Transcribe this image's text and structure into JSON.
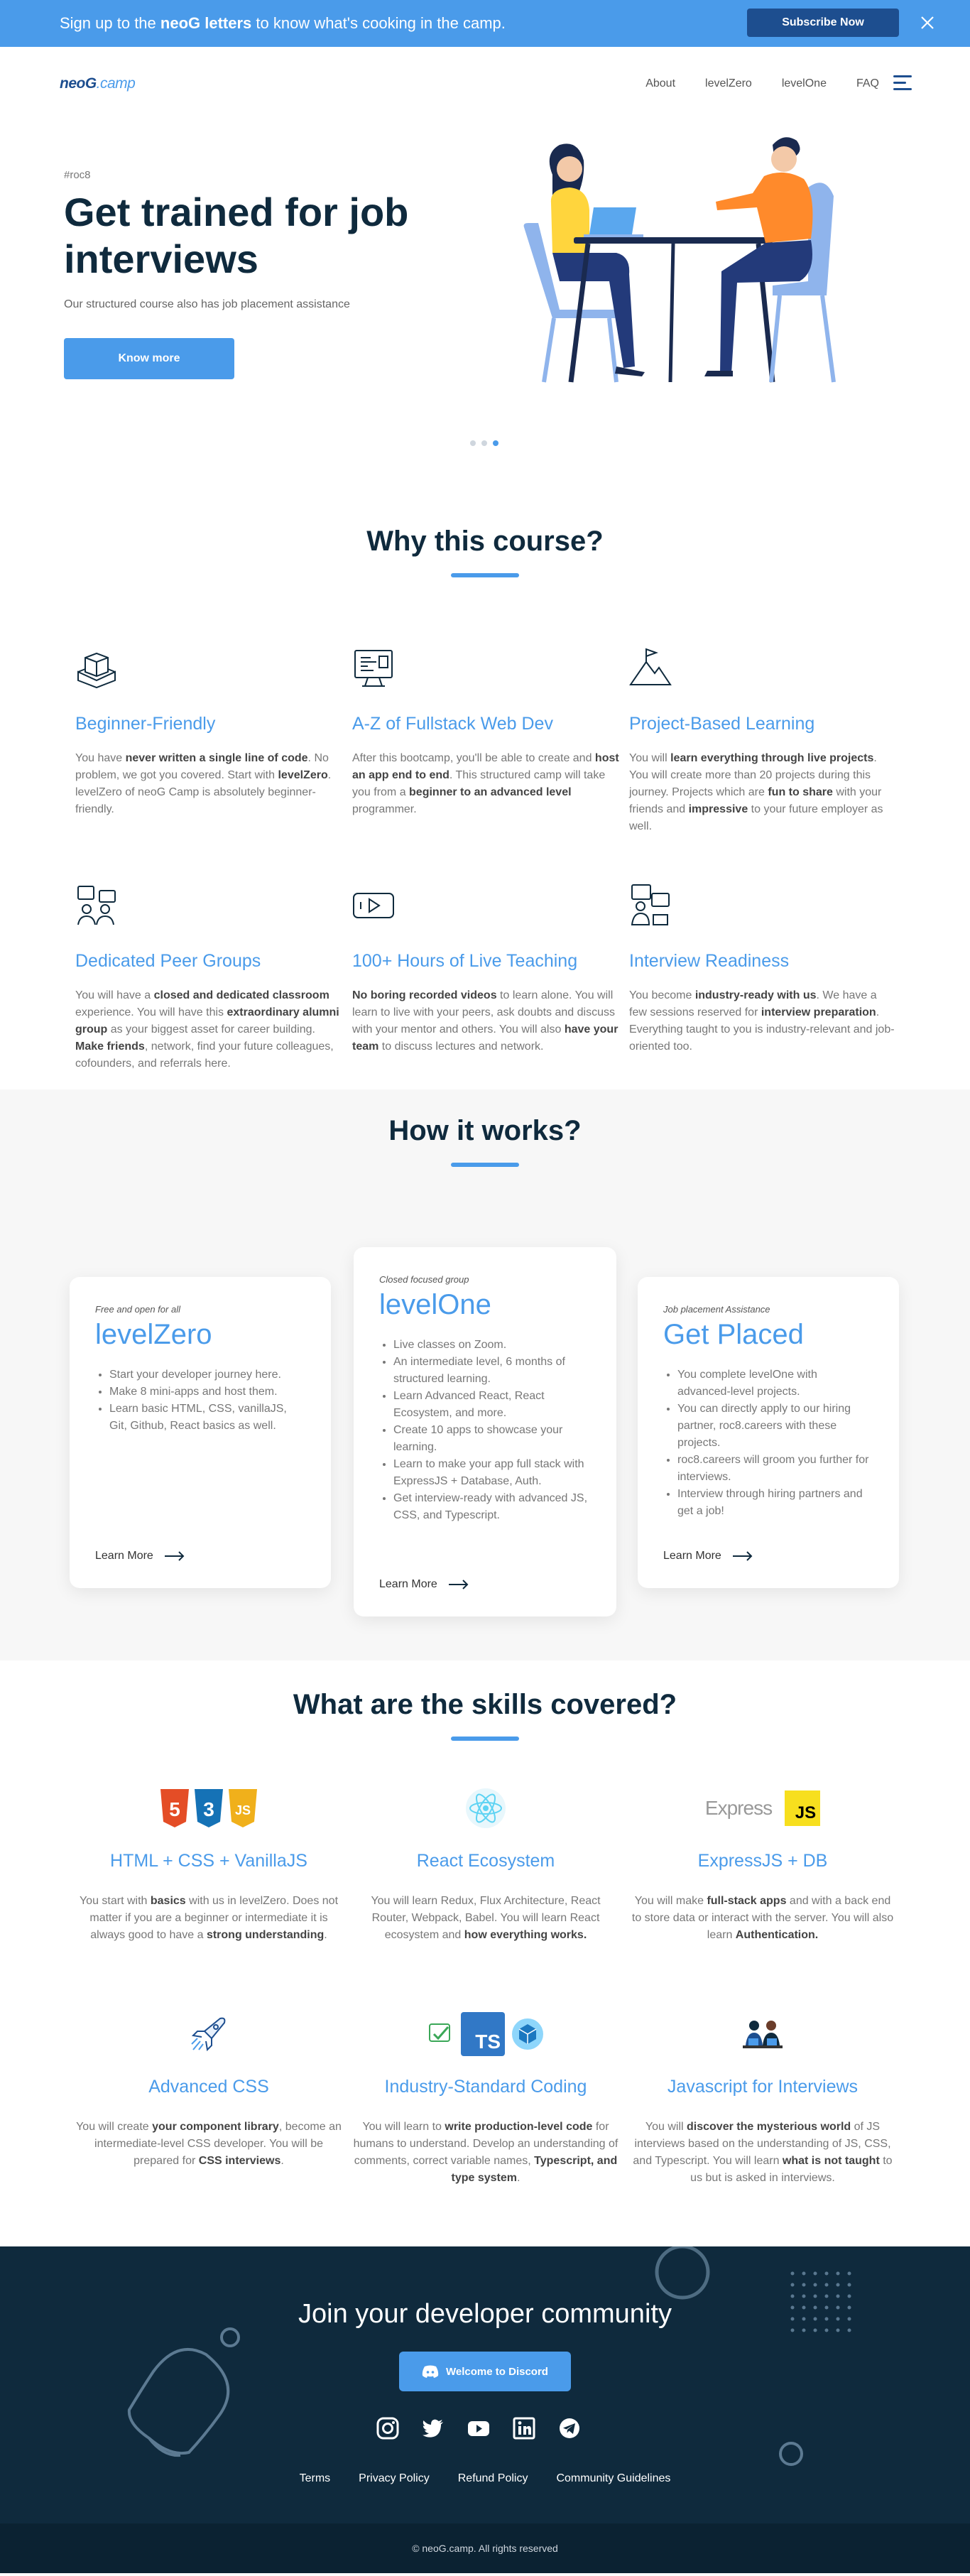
{
  "banner": {
    "text_pre": "Sign up to the ",
    "text_bold": "neoG letters",
    "text_post": " to know what's cooking in the camp.",
    "button": "Subscribe Now"
  },
  "nav": {
    "logo_main": "neoG",
    "logo_dot": ".camp",
    "links": [
      "About",
      "levelZero",
      "levelOne",
      "FAQ"
    ]
  },
  "hero": {
    "tag": "#roc8",
    "title": "Get trained for job interviews",
    "subtitle": "Our structured course also has job placement assistance",
    "button": "Know more"
  },
  "why": {
    "title": "Why this course?",
    "features": [
      {
        "icon": "blocks-icon",
        "title": "Beginner-Friendly",
        "parts": [
          [
            "You have ",
            0
          ],
          [
            "never written a single line of code",
            1
          ],
          [
            ". No problem, we got you covered. Start with ",
            0
          ],
          [
            "levelZero",
            1
          ],
          [
            ". levelZero of neoG Camp is absolutely beginner-friendly.",
            0
          ]
        ]
      },
      {
        "icon": "monitor-code-icon",
        "title": "A-Z of Fullstack Web Dev",
        "parts": [
          [
            "After this bootcamp, you'll be able to create and ",
            0
          ],
          [
            "host an app end to end",
            1
          ],
          [
            ". This structured camp will take you from a ",
            0
          ],
          [
            "beginner to an advanced level",
            1
          ],
          [
            " programmer.",
            0
          ]
        ]
      },
      {
        "icon": "mountain-flag-icon",
        "title": "Project-Based Learning",
        "parts": [
          [
            "You will ",
            0
          ],
          [
            "learn everything through live projects",
            1
          ],
          [
            ". You will create more than 20 projects during this journey. Projects which are ",
            0
          ],
          [
            "fun to share",
            1
          ],
          [
            " with your friends and ",
            0
          ],
          [
            "impressive",
            1
          ],
          [
            " to your future employer as well.",
            0
          ]
        ]
      },
      {
        "icon": "peer-group-icon",
        "title": "Dedicated Peer Groups",
        "parts": [
          [
            "You will have a ",
            0
          ],
          [
            "closed and dedicated classroom",
            1
          ],
          [
            " experience. You will have this ",
            0
          ],
          [
            "extraordinary alumni group",
            1
          ],
          [
            " as your biggest asset for career building. ",
            0
          ],
          [
            "Make friends",
            1
          ],
          [
            ", network, find your future colleagues, cofounders, and referrals here.",
            0
          ]
        ]
      },
      {
        "icon": "video-play-icon",
        "title": "100+ Hours of Live Teaching",
        "parts": [
          [
            "No boring recorded videos",
            1
          ],
          [
            " to learn alone. You will learn to live with your peers, ask doubts and discuss with your mentor and others. You will also ",
            0
          ],
          [
            "have your team",
            1
          ],
          [
            " to discuss lectures and network.",
            0
          ]
        ]
      },
      {
        "icon": "interview-icon",
        "title": "Interview Readiness",
        "parts": [
          [
            "You become ",
            0
          ],
          [
            "industry-ready with us",
            1
          ],
          [
            ". We have a few sessions reserved for ",
            0
          ],
          [
            "interview preparation",
            1
          ],
          [
            ". Everything taught to you is industry-relevant and job-oriented too.",
            0
          ]
        ]
      }
    ]
  },
  "how": {
    "title": "How it works?",
    "cards": [
      {
        "caption": "Free and open for all",
        "title": "levelZero",
        "items": [
          "Start your developer journey here.",
          "Make 8 mini-apps and host them.",
          "Learn basic HTML, CSS, vanillaJS, Git, Github, React basics as well."
        ],
        "link": "Learn More"
      },
      {
        "caption": "Closed focused group",
        "title": "levelOne",
        "items": [
          "Live classes on Zoom.",
          "An intermediate level, 6 months of structured learning.",
          "Learn Advanced React, React Ecosystem, and more.",
          "Create 10 apps to showcase your learning.",
          "Learn to make your app full stack with ExpressJS + Database, Auth.",
          "Get interview-ready with advanced JS, CSS, and Typescript."
        ],
        "link": "Learn More"
      },
      {
        "caption": "Job placement Assistance",
        "title": "Get Placed",
        "items": [
          "You complete levelOne with advanced-level projects.",
          "You can directly apply to our hiring partner, roc8.careers with these projects.",
          "roc8.careers will groom you further for interviews.",
          "Interview through hiring partners and get a job!"
        ],
        "link": "Learn More"
      }
    ]
  },
  "skills": {
    "title": "What are the skills covered?",
    "items": [
      {
        "icon": "html-css-js-icon",
        "title": "HTML + CSS + VanillaJS",
        "parts": [
          [
            "You start with ",
            0
          ],
          [
            "basics",
            1
          ],
          [
            " with us in levelZero. Does not matter if you are a beginner or intermediate it is always good to have a ",
            0
          ],
          [
            "strong understanding",
            1
          ],
          [
            ".",
            0
          ]
        ]
      },
      {
        "icon": "react-icon",
        "title": "React Ecosystem",
        "parts": [
          [
            "You will learn Redux, Flux Architecture, React Router, Webpack, Babel. You will learn React ecosystem and ",
            0
          ],
          [
            "how everything works.",
            1
          ]
        ]
      },
      {
        "icon": "express-js-icon",
        "title": "ExpressJS + DB",
        "parts": [
          [
            "You will make ",
            0
          ],
          [
            "full-stack apps",
            1
          ],
          [
            " and with a back end to store data or interact with the server. You will also learn ",
            0
          ],
          [
            "Authentication.",
            1
          ]
        ]
      },
      {
        "icon": "rocket-icon",
        "title": "Advanced CSS",
        "parts": [
          [
            "You will create ",
            0
          ],
          [
            "your component library",
            1
          ],
          [
            ", become an intermediate-level CSS developer. You will be prepared for ",
            0
          ],
          [
            "CSS interviews",
            1
          ],
          [
            ".",
            0
          ]
        ]
      },
      {
        "icon": "typescript-icon",
        "title": "Industry-Standard Coding",
        "parts": [
          [
            "You will learn to ",
            0
          ],
          [
            "write production-level code",
            1
          ],
          [
            " for humans to understand. Develop an understanding of comments, correct variable names, ",
            0
          ],
          [
            "Typescript, and type system",
            1
          ],
          [
            ".",
            0
          ]
        ]
      },
      {
        "icon": "developers-icon",
        "title": "Javascript for Interviews",
        "parts": [
          [
            "You will ",
            0
          ],
          [
            "discover the mysterious world",
            1
          ],
          [
            " of JS interviews based on the understanding of JS, CSS, and Typescript. You will learn ",
            0
          ],
          [
            "what is not taught",
            1
          ],
          [
            " to us but is asked in interviews.",
            0
          ]
        ]
      }
    ],
    "logos": {
      "express": "Express",
      "js": "JS",
      "ts": "TS",
      "h5": "5",
      "c3": "3"
    }
  },
  "footer": {
    "join": "Join your developer community",
    "discord": "Welcome to Discord",
    "socials": [
      "instagram-icon",
      "twitter-icon",
      "youtube-icon",
      "linkedin-icon",
      "telegram-icon"
    ],
    "links": [
      "Terms",
      "Privacy Policy",
      "Refund Policy",
      "Community Guidelines"
    ],
    "copyright": "© neoG.camp. All rights reserved"
  },
  "colors": {
    "accent": "#4a9bea",
    "navy": "#0f2a3d",
    "banner_button": "#1d4e8f"
  }
}
